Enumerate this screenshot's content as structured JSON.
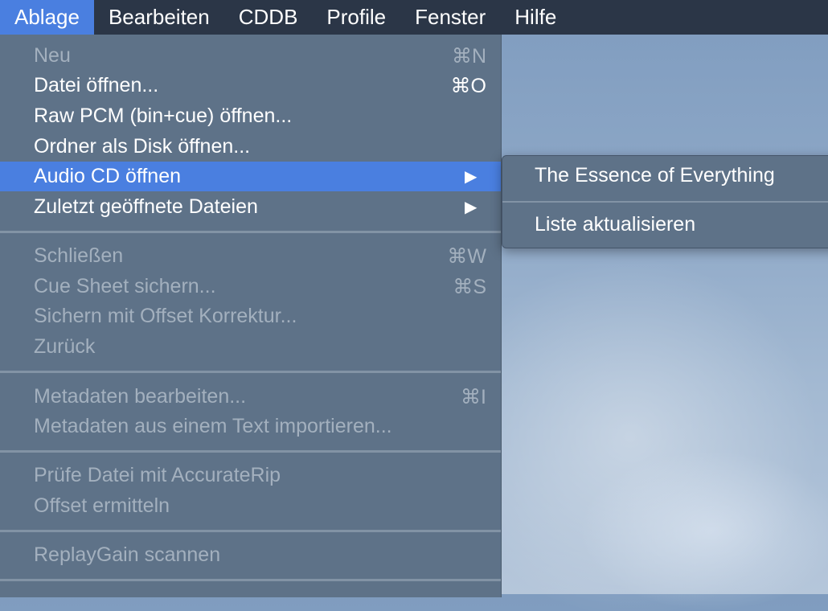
{
  "menubar": {
    "items": [
      {
        "label": "Ablage"
      },
      {
        "label": "Bearbeiten"
      },
      {
        "label": "CDDB"
      },
      {
        "label": "Profile"
      },
      {
        "label": "Fenster"
      },
      {
        "label": "Hilfe"
      }
    ]
  },
  "file_menu": {
    "items": [
      {
        "label": "Neu",
        "shortcut": "⌘N",
        "enabled": false
      },
      {
        "label": "Datei öffnen...",
        "shortcut": "⌘O",
        "enabled": true
      },
      {
        "label": "Raw PCM (bin+cue) öffnen...",
        "enabled": true
      },
      {
        "label": "Ordner als Disk öffnen...",
        "enabled": true
      },
      {
        "label": "Audio CD öffnen",
        "submenu_arrow": "▶",
        "enabled": true,
        "highlighted": true
      },
      {
        "label": "Zuletzt geöffnete Dateien",
        "submenu_arrow": "▶",
        "enabled": true
      },
      {
        "label": "Schließen",
        "shortcut": "⌘W",
        "enabled": false
      },
      {
        "label": "Cue Sheet sichern...",
        "shortcut": "⌘S",
        "enabled": false
      },
      {
        "label": "Sichern mit Offset Korrektur...",
        "enabled": false
      },
      {
        "label": "Zurück",
        "enabled": false
      },
      {
        "label": "Metadaten bearbeiten...",
        "shortcut": "⌘I",
        "enabled": false
      },
      {
        "label": "Metadaten aus einem Text importieren...",
        "enabled": false
      },
      {
        "label": "Prüfe Datei mit AccurateRip",
        "enabled": false
      },
      {
        "label": "Offset ermitteln",
        "enabled": false
      },
      {
        "label": "ReplayGain scannen",
        "enabled": false
      }
    ]
  },
  "audio_cd_submenu": {
    "items": [
      {
        "label": "The Essence of Everything"
      },
      {
        "label": "Liste aktualisieren"
      }
    ]
  },
  "colors": {
    "menubar_bg": "#2b3647",
    "highlight": "#4a7fe0",
    "menu_bg": "#5e7288",
    "disabled_text": "#a3b0be"
  }
}
